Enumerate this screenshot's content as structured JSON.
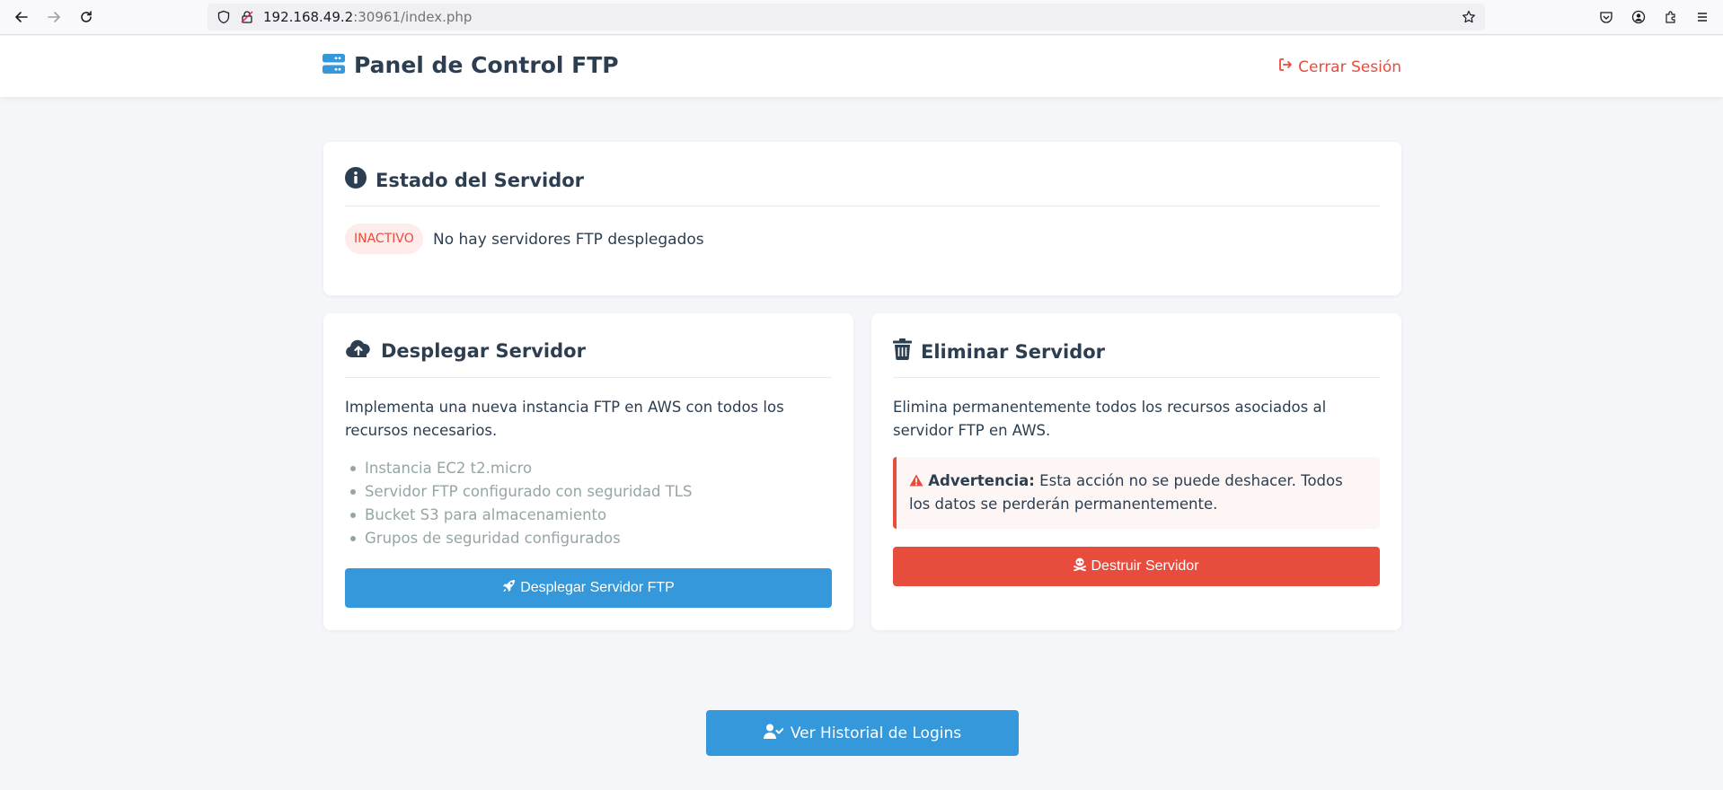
{
  "browser": {
    "url_host": "192.168.49.2",
    "url_rest": ":30961/index.php"
  },
  "header": {
    "title": "Panel de Control FTP",
    "logout_label": "Cerrar Sesión",
    "logout_color": "#e74c3c"
  },
  "status_card": {
    "title": "Estado del Servidor",
    "badge": "INACTIVO",
    "message": "No hay servidores FTP desplegados"
  },
  "deploy_card": {
    "title": "Desplegar Servidor",
    "description": "Implementa una nueva instancia FTP en AWS con todos los recursos necesarios.",
    "features": [
      "Instancia EC2 t2.micro",
      "Servidor FTP configurado con seguridad TLS",
      "Bucket S3 para almacenamiento",
      "Grupos de seguridad configurados"
    ],
    "button_label": "Desplegar Servidor FTP",
    "button_color": "#3498db"
  },
  "delete_card": {
    "title": "Eliminar Servidor",
    "description": "Elimina permanentemente todos los recursos asociados al servidor FTP en AWS.",
    "warning_strong": "Advertencia:",
    "warning_text": " Esta acción no se puede deshacer. Todos los datos se perderán permanentemente.",
    "button_label": "Destruir Servidor",
    "button_color": "#e74c3c"
  },
  "history_button_label": "Ver Historial de Logins",
  "icons": {
    "brand": "server-icon",
    "logout": "sign-out-icon",
    "status": "info-circle-icon",
    "deploy": "cloud-upload-icon",
    "delete": "trash-icon",
    "warning": "warning-triangle-icon",
    "rocket": "rocket-icon",
    "skull": "skull-crossbones-icon",
    "history": "user-check-icon"
  }
}
